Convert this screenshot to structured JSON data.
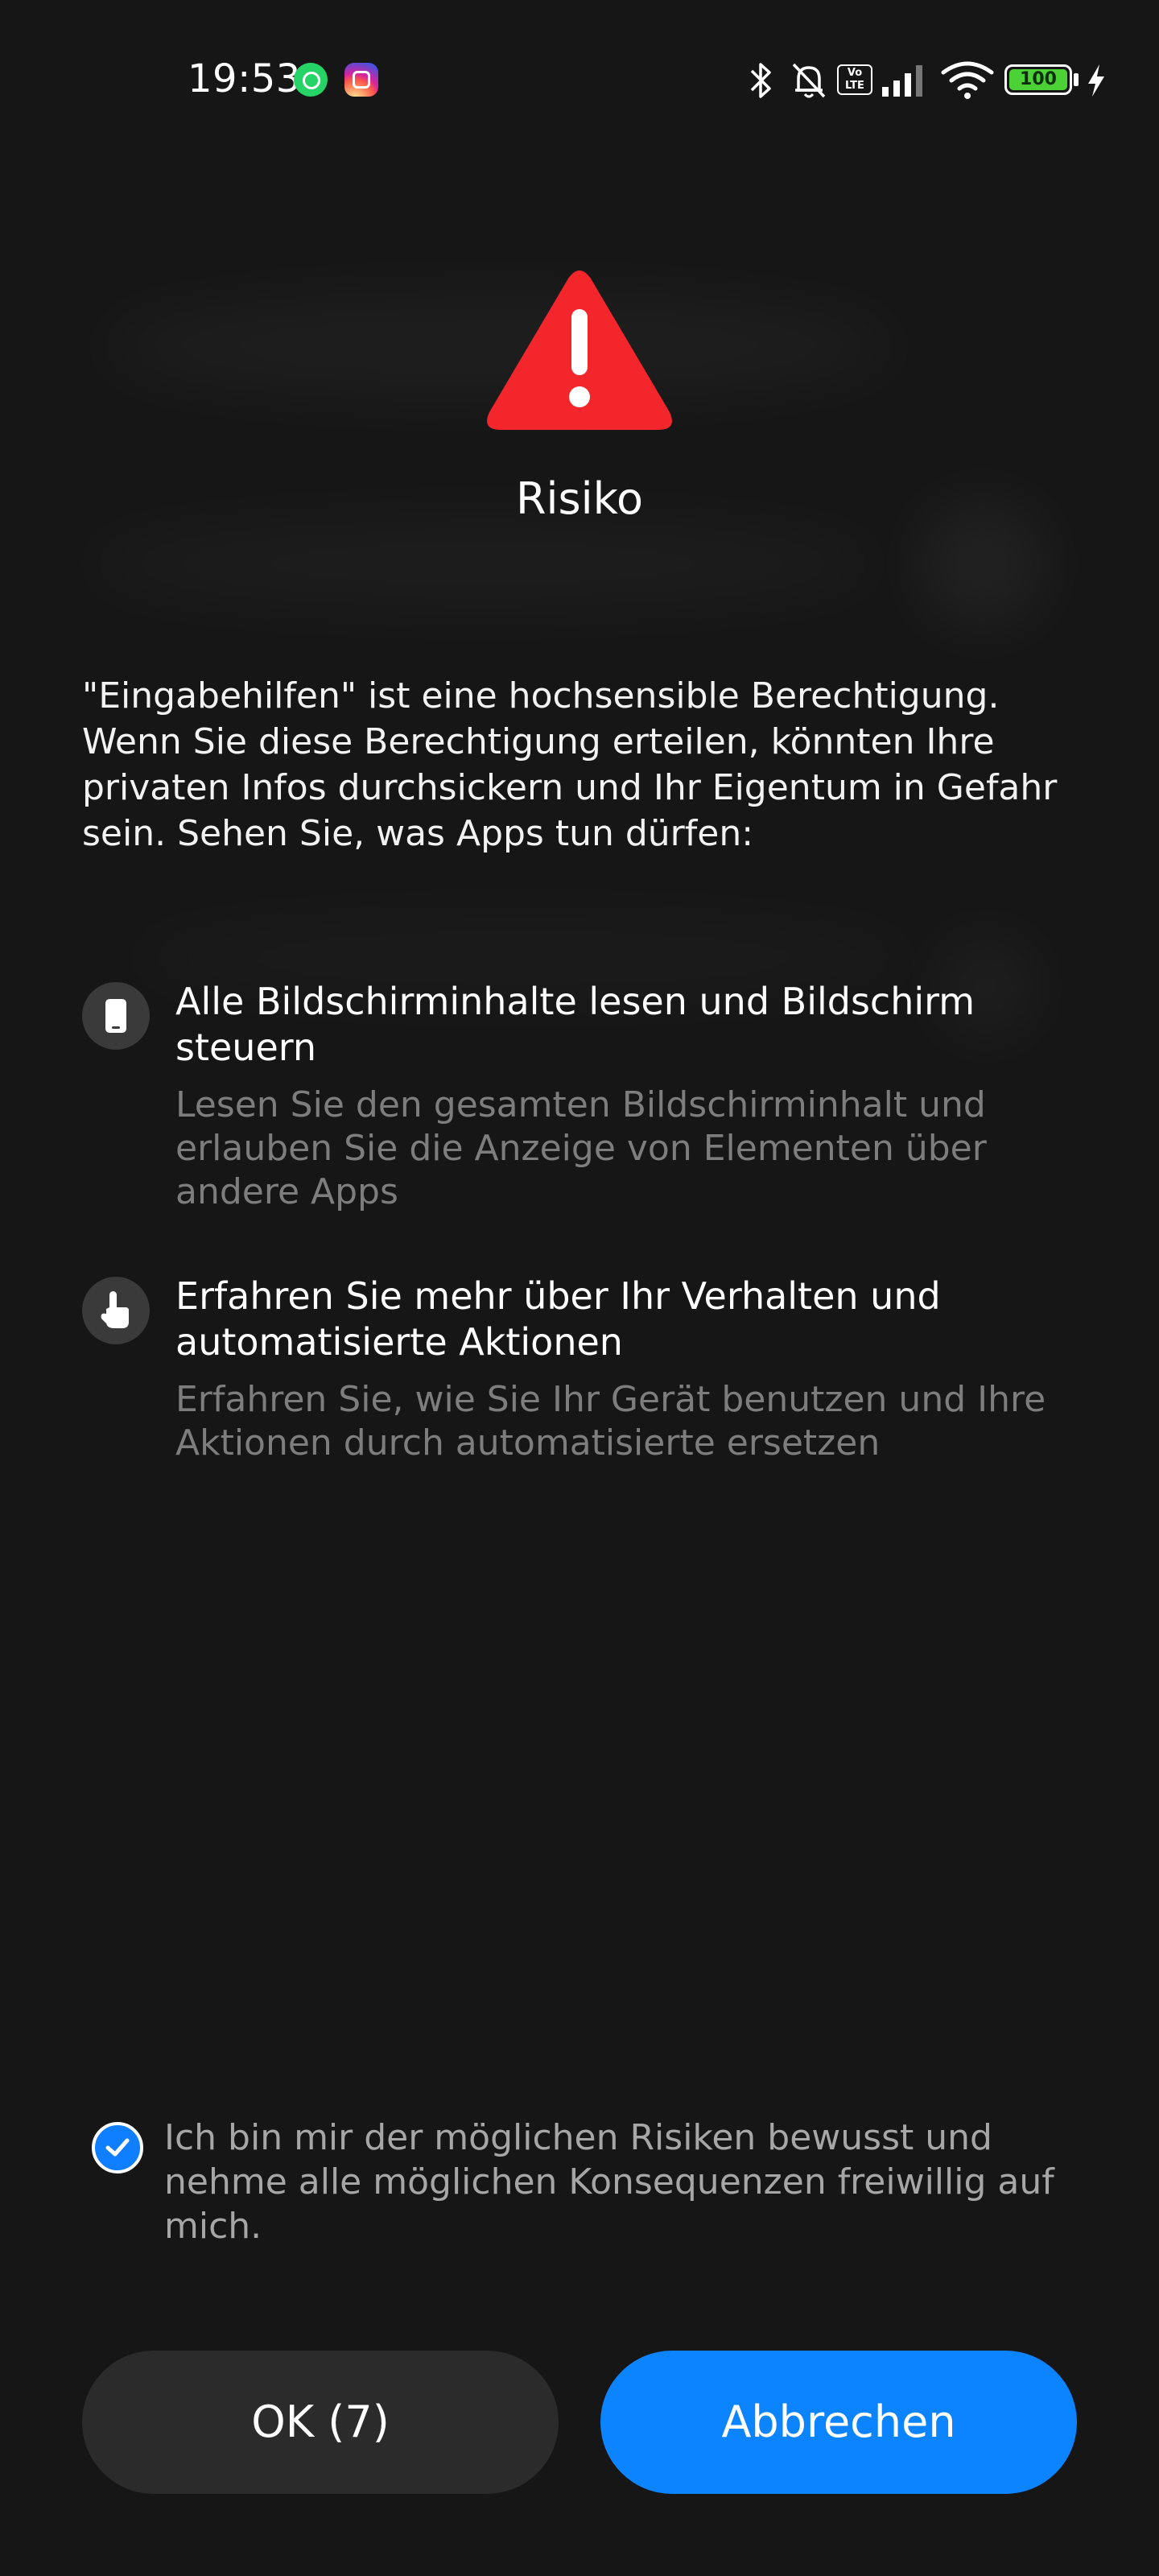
{
  "status_bar": {
    "time": "19:53",
    "battery_level": "100",
    "icons": [
      "whatsapp-icon",
      "instagram-icon",
      "bluetooth-icon",
      "bell-off-icon",
      "volte-icon",
      "signal-icon",
      "wifi-icon",
      "battery-icon",
      "charging-icon"
    ],
    "volte_label": "Vo\nLTE"
  },
  "dialog": {
    "title": "Risiko",
    "warning_color": "#f2262b",
    "intro": "\"Eingabehilfen\" ist eine hochsensible Berechtigung. Wenn Sie diese Berechtigung erteilen, könnten Ihre privaten Infos durchsickern und Ihr Eigentum in Gefahr sein. Sehen Sie, was Apps tun dürfen:",
    "permissions": [
      {
        "icon": "phone-screen-icon",
        "title": "Alle Bildschirminhalte lesen und Bildschirm steuern",
        "description": "Lesen Sie den gesamten Bildschirminhalt und erlauben Sie die Anzeige von Elementen über andere Apps"
      },
      {
        "icon": "hand-pointer-icon",
        "title": "Erfahren Sie mehr über Ihr Verhalten und automatisierte Aktionen",
        "description": "Erfahren Sie, wie Sie Ihr Gerät benutzen und Ihre Aktionen durch automatisierte ersetzen"
      }
    ],
    "consent": {
      "checked": true,
      "text": "Ich bin mir der möglichen Risiken bewusst und nehme alle möglichen Konsequenzen freiwillig auf mich."
    },
    "buttons": {
      "ok_label": "OK (7)",
      "cancel_label": "Abbrechen"
    },
    "accent_color": "#0d84ff"
  }
}
